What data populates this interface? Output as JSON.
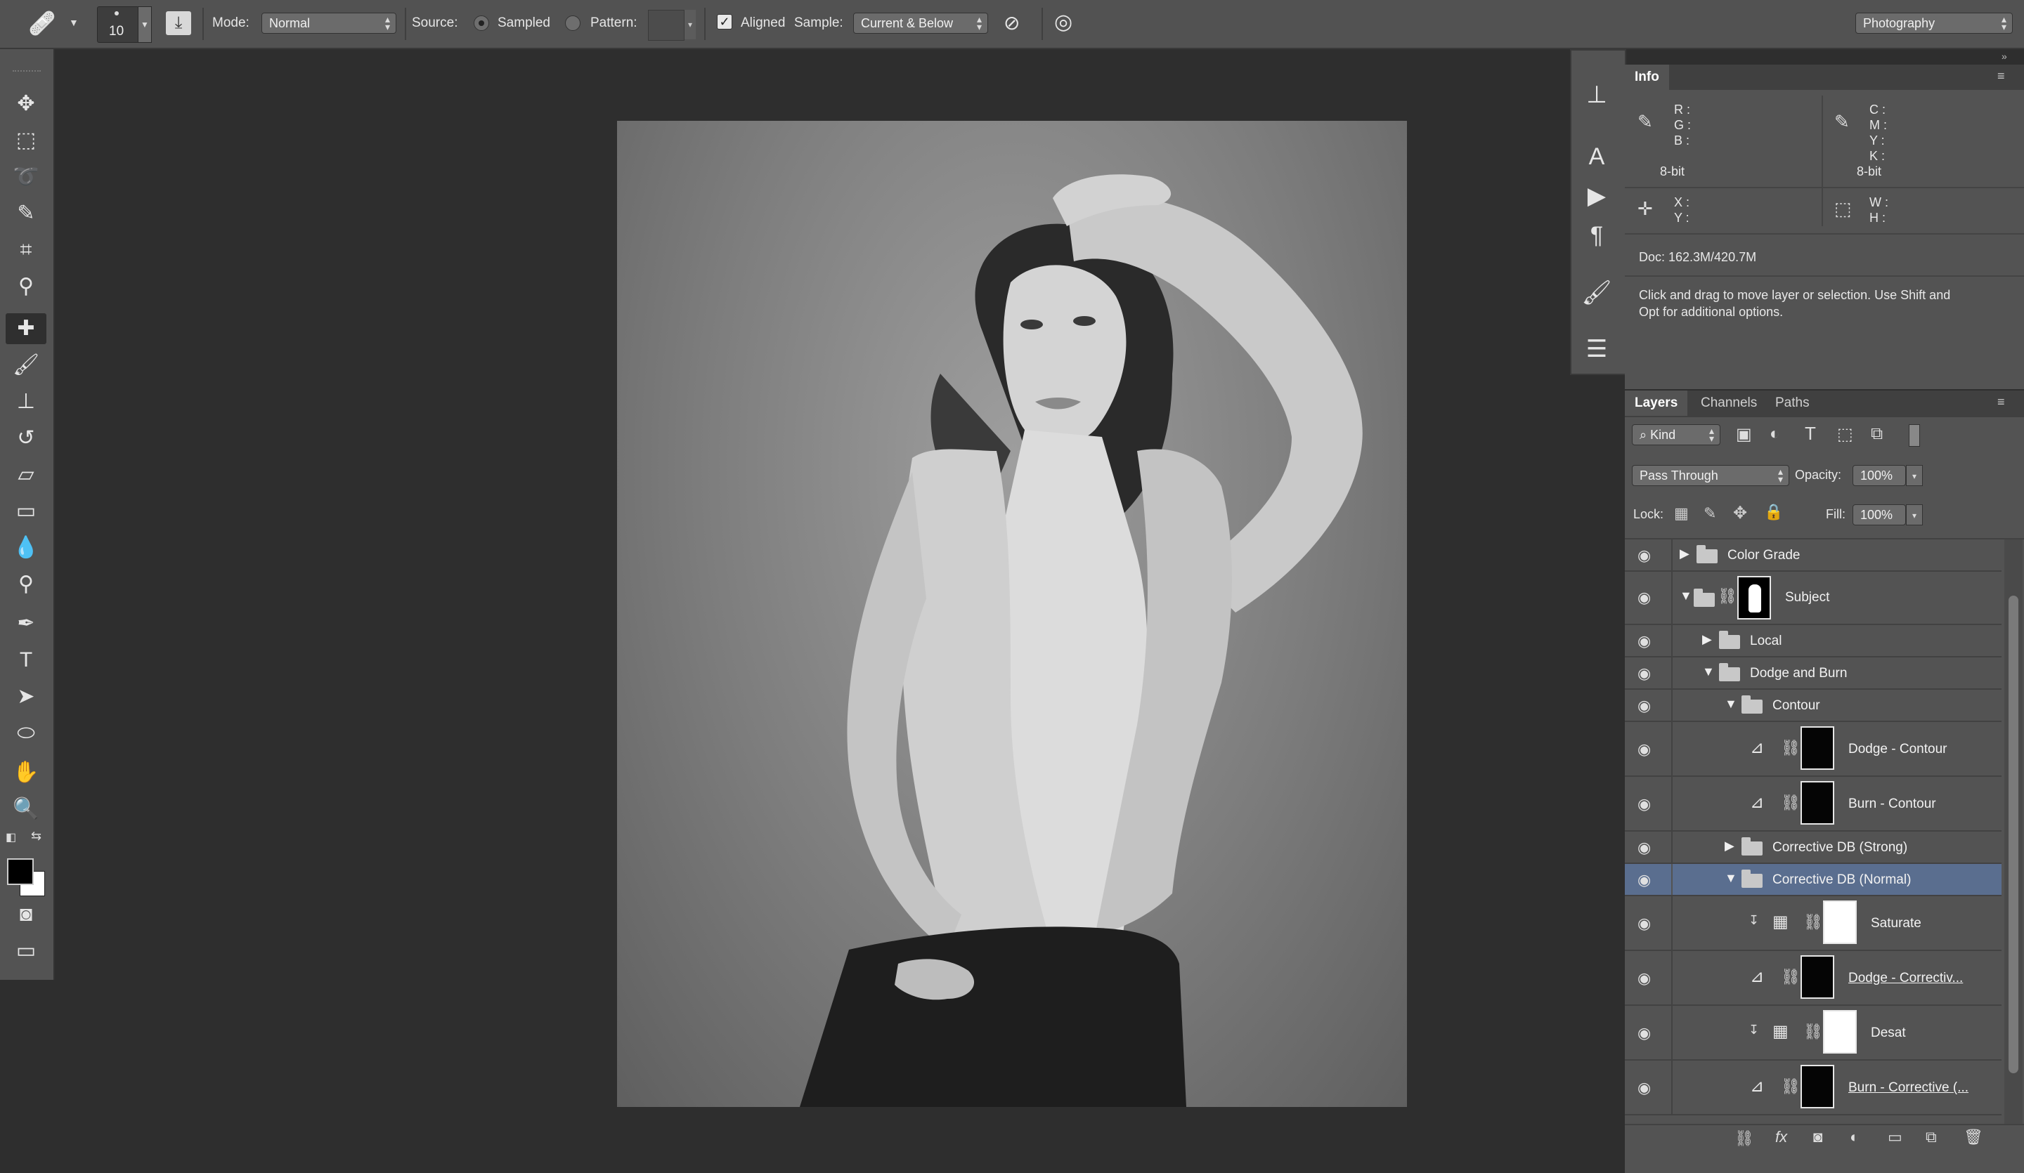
{
  "options_bar": {
    "brush_size": "10",
    "mode_label": "Mode:",
    "mode_value": "Normal",
    "source_label": "Source:",
    "sampled_label": "Sampled",
    "pattern_label": "Pattern:",
    "aligned_label": "Aligned",
    "sample_label": "Sample:",
    "sample_value": "Current & Below",
    "workspace_value": "Photography"
  },
  "info_panel": {
    "tab": "Info",
    "rgb_labels": [
      "R :",
      "G :",
      "B :"
    ],
    "cmyk_labels": [
      "C :",
      "M :",
      "Y :",
      "K :"
    ],
    "bitdepth_left": "8-bit",
    "bitdepth_right": "8-bit",
    "xy_labels": [
      "X :",
      "Y :"
    ],
    "wh_labels": [
      "W :",
      "H :"
    ],
    "doc_size": "Doc: 162.3M/420.7M",
    "hint_line1": "Click and drag to move layer or selection.  Use Shift and",
    "hint_line2": "Opt for additional options."
  },
  "layers_panel": {
    "tabs": [
      "Layers",
      "Channels",
      "Paths"
    ],
    "filter_label": "Kind",
    "blend_mode": "Pass Through",
    "opacity_label": "Opacity:",
    "opacity_value": "100%",
    "lock_label": "Lock:",
    "fill_label": "Fill:",
    "fill_value": "100%",
    "layers": [
      {
        "name": "Color Grade"
      },
      {
        "name": "Subject"
      },
      {
        "name": "Local"
      },
      {
        "name": "Dodge and Burn"
      },
      {
        "name": "Contour"
      },
      {
        "name": "Dodge - Contour"
      },
      {
        "name": "Burn - Contour"
      },
      {
        "name": "Corrective DB (Strong)"
      },
      {
        "name": "Corrective DB (Normal)"
      },
      {
        "name": "Saturate"
      },
      {
        "name": "Dodge - Correctiv..."
      },
      {
        "name": "Desat"
      },
      {
        "name": "Burn - Corrective (..."
      }
    ]
  },
  "colors": {
    "workspace_bg": "#2e2e2e",
    "panel_bg": "#535353",
    "selected_row": "#5a6e8f"
  }
}
